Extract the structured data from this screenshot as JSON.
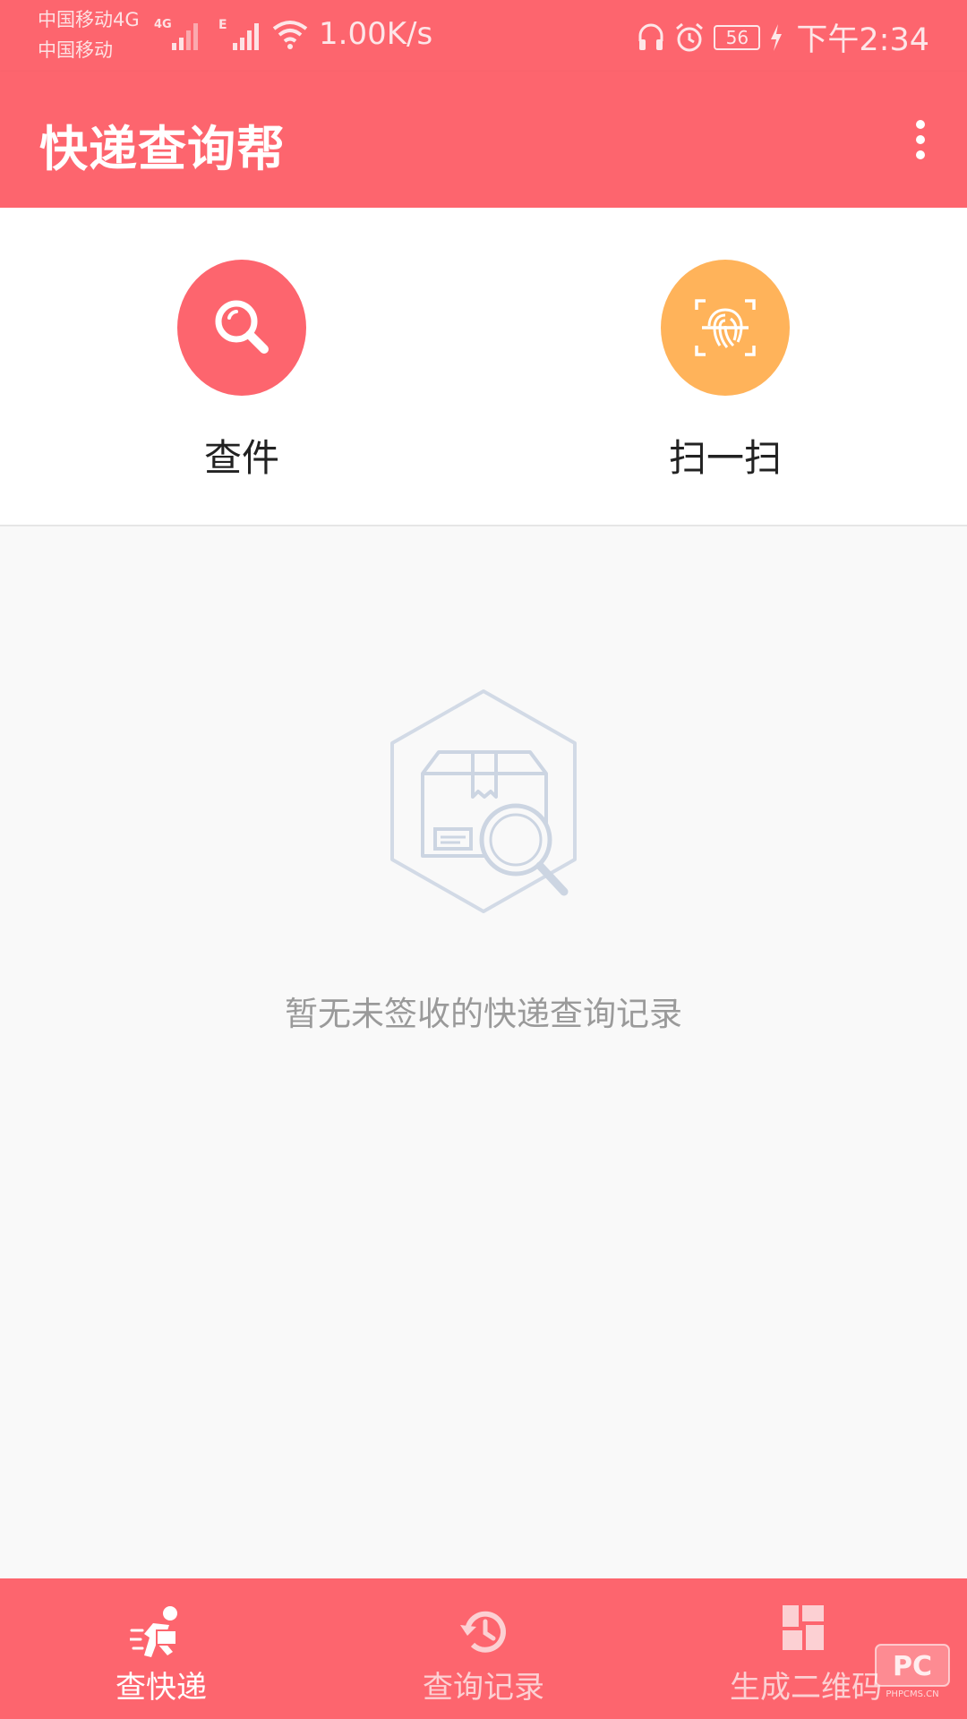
{
  "status_bar": {
    "carrier_line1": "中国移动4G",
    "carrier_line2": "中国移动",
    "net_badge": "4G",
    "edge_badge": "E",
    "speed": "1.00K/s",
    "battery": "56",
    "time": "下午2:34"
  },
  "app_bar": {
    "title": "快递查询帮",
    "menu_icon": "more-vert-icon"
  },
  "actions": [
    {
      "label": "查件",
      "icon": "search-icon",
      "color": "#fd656e"
    },
    {
      "label": "扫一扫",
      "icon": "scan-fingerprint-icon",
      "color": "#ffb35a"
    }
  ],
  "empty_state": {
    "icon": "package-search-icon",
    "message": "暂无未签收的快递查询记录"
  },
  "bottom_nav": {
    "items": [
      {
        "label": "查快递",
        "icon": "runner-icon",
        "active": true
      },
      {
        "label": "查询记录",
        "icon": "history-icon",
        "active": false
      },
      {
        "label": "生成二维码",
        "icon": "qr-grid-icon",
        "active": false
      }
    ]
  },
  "watermark": {
    "logo": "PC",
    "caption": "PHPCMS.CN"
  },
  "colors": {
    "primary": "#fd656e",
    "scan": "#ffb35a",
    "background": "#f9f9f9"
  }
}
